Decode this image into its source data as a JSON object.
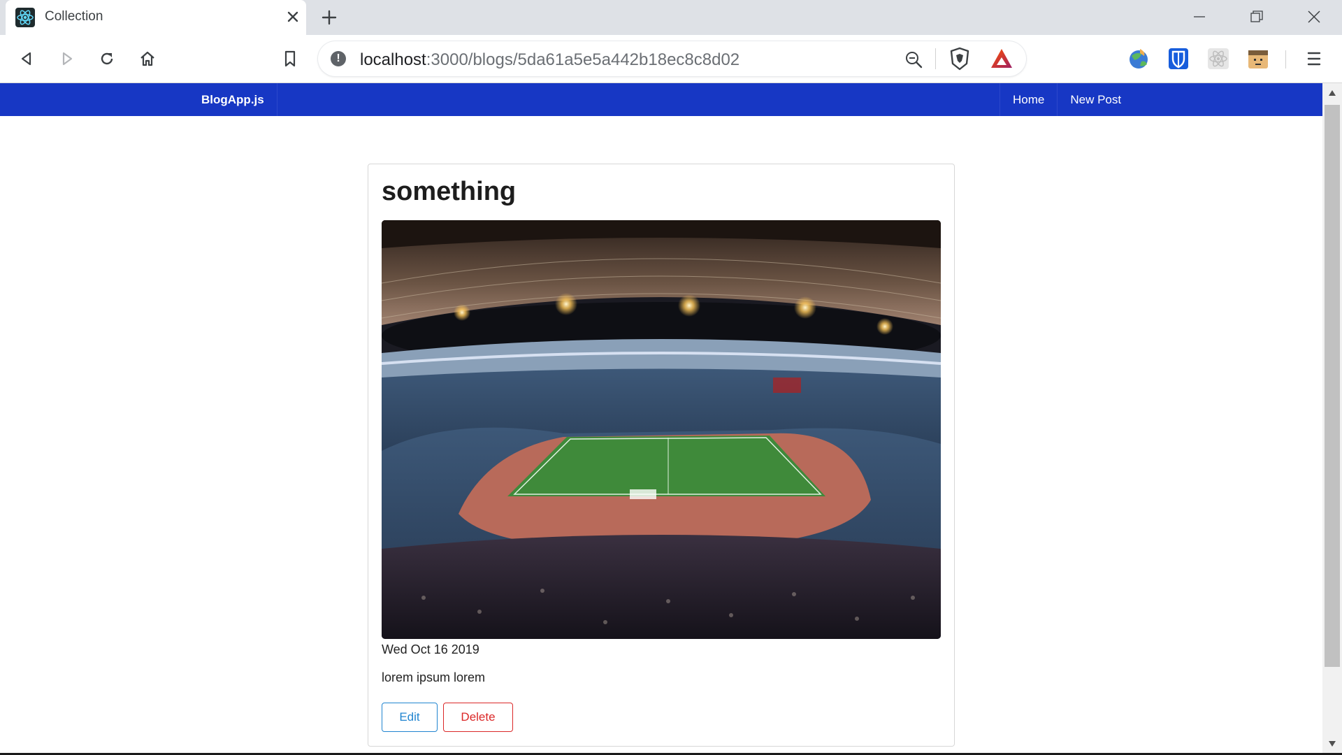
{
  "browser": {
    "tab_title": "Collection",
    "url_host": "localhost",
    "url_rest": ":3000/blogs/5da61a5e5a442b18ec8c8d02"
  },
  "navbar": {
    "brand": "BlogApp.js",
    "links": [
      "Home",
      "New Post"
    ],
    "color": "#1737c4"
  },
  "post": {
    "title": "something",
    "date": "Wed Oct 16 2019",
    "body": "lorem ipsum lorem",
    "image": "stadium-photo"
  },
  "actions": {
    "edit_label": "Edit",
    "delete_label": "Delete",
    "edit_color": "#2185d0",
    "delete_color": "#db2828"
  },
  "icons": [
    "react-icon",
    "close-icon",
    "plus-icon",
    "back-icon",
    "forward-icon",
    "reload-icon",
    "home-icon",
    "bookmark-icon",
    "info-icon",
    "zoom-out-icon",
    "brave-shields-icon",
    "bat-rewards-icon",
    "globe-extension-icon",
    "bitwarden-icon",
    "react-devtools-icon",
    "extension-face-icon",
    "menu-icon"
  ]
}
